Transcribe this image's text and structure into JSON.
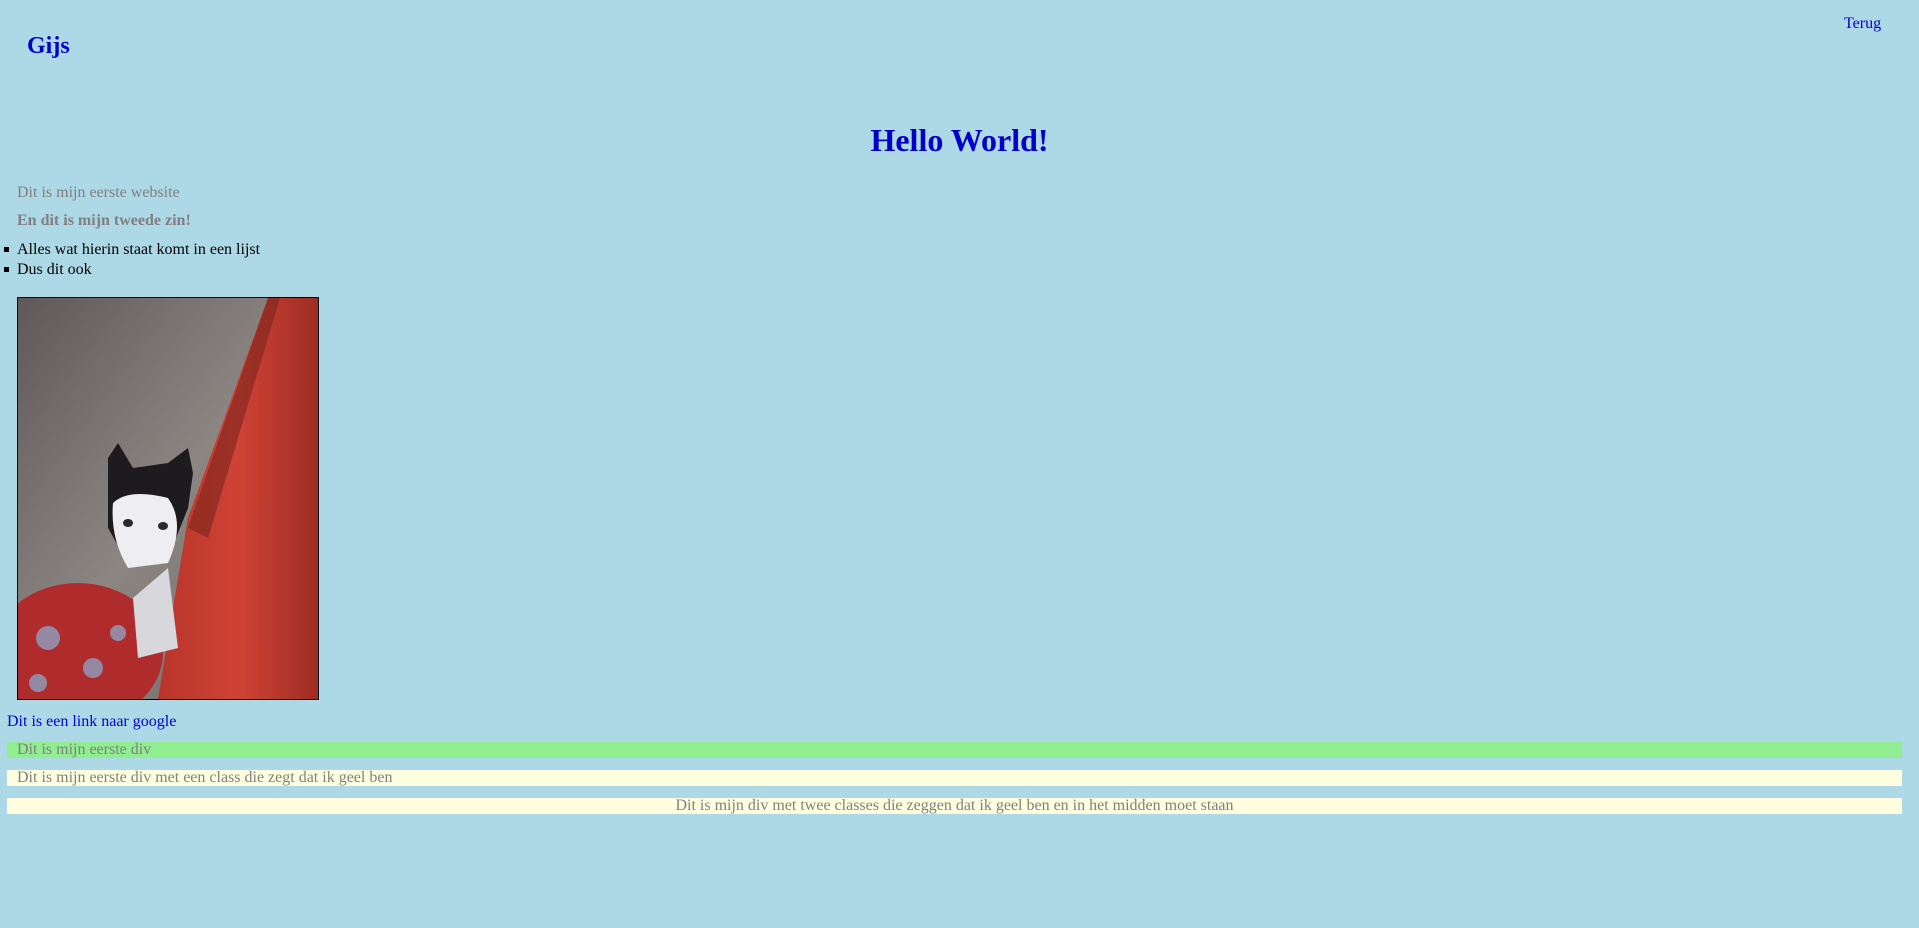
{
  "header": {
    "site_name": "Gijs",
    "back_link": "Terug"
  },
  "main": {
    "title": "Hello World!",
    "first_sentence": "Dit is mijn eerste website",
    "second_sentence": "En dit is mijn tweede zin!",
    "list_items": [
      "Alles wat hierin staat komt in een lijst",
      "Dus dit ook"
    ],
    "image": {
      "subject": "cat-photo"
    },
    "google_link": "Dit is een link naar google",
    "divs": {
      "green": "Dit is mijn eerste div",
      "yellow": "Dit is mijn eerste div met een class die zegt dat ik geel ben",
      "yellow_center": "Dit is mijn div met twee classes die zeggen dat ik geel ben en in het midden moet staan"
    }
  },
  "colors": {
    "background": "#add8e6",
    "link": "#0000cd",
    "muted_text": "#808080",
    "green_div": "#90ee90",
    "yellow_div": "#ffffe0"
  }
}
